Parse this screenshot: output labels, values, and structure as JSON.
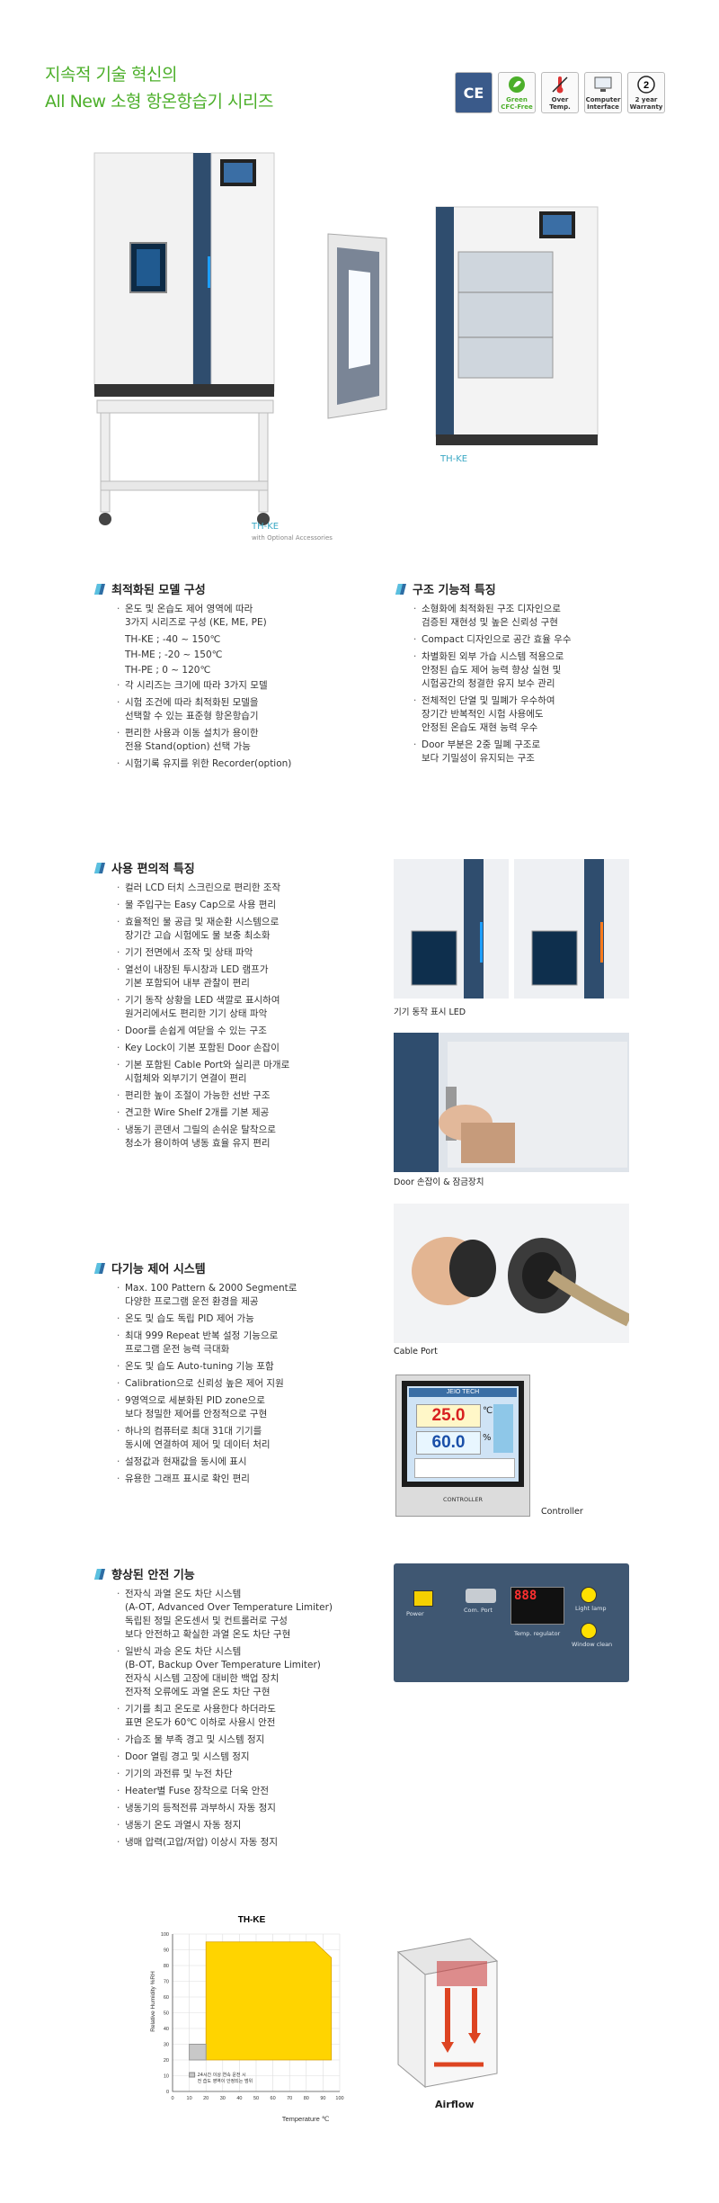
{
  "header": {
    "title_line1": "지속적 기술 혁신의",
    "title_line2": "All New 소형 항온항습기 시리즈",
    "badges": [
      {
        "label": "CE",
        "icon": "ce-icon"
      },
      {
        "label": "Green CFC-Free",
        "icon": "leaf-icon"
      },
      {
        "label": "Over Temp.",
        "icon": "thermometer-icon"
      },
      {
        "label": "Computer Interface",
        "icon": "computer-icon"
      },
      {
        "label": "2 year Warranty",
        "icon": "warranty-icon"
      }
    ]
  },
  "products": {
    "left_caption": "TH-KE",
    "left_subcaption": "with Optional Accessories",
    "right_caption": "TH-KE"
  },
  "section_model": {
    "heading": "최적화된 모델 구성",
    "items": [
      "온도 및 온습도 제어 영역에 따라\n3가지 시리즈로 구성 (KE, ME, PE)",
      "TH-KE ; -40 ~ 150℃",
      "TH-ME ; -20 ~ 150℃",
      "TH-PE ; 0 ~ 120℃",
      "각 시리즈는 크기에 따라 3가지 모델",
      "시험 조건에 따라 최적화된 모델을\n선택할 수 있는 표준형 항온항습기",
      "편리한 사용과 이동 설치가 용이한\n전용 Stand(option) 선택 가능",
      "시험기록 유지를 위한 Recorder(option)"
    ]
  },
  "section_structure": {
    "heading": "구조 기능적 특징",
    "items": [
      "소형화에 최적화된 구조 디자인으로\n검증된 재현성 및 높은 신뢰성 구현",
      "Compact 디자인으로 공간 효율 우수",
      "차별화된 외부 가습 시스템 적용으로\n안정된 습도 제어 능력 향상 실현 및\n시험공간의 청결한 유지 보수 관리",
      "전체적인 단열 및 밀폐가 우수하여\n장기간 반복적인 시험 사용에도\n안정된 온습도 재현 능력 우수",
      "Door 부분은 2중 밀폐 구조로\n보다 기밀성이 유지되는 구조"
    ]
  },
  "section_usability": {
    "heading": "사용 편의적 특징",
    "items": [
      "컬러 LCD 터치 스크린으로 편리한 조작",
      "물 주입구는 Easy Cap으로 사용 편리",
      "효율적인 물 공급 및 재순환 시스템으로\n장기간 고습 시험에도 물 보충 최소화",
      "기기 전면에서 조작 및 상태 파악",
      "열선이 내장된 투시창과 LED 램프가\n기본 포함되어 내부 관찰이 편리",
      "기기 동작 상황을 LED 색깔로 표시하여\n원거리에서도 편리한 기기 상태 파악",
      "Door를 손쉽게 여닫을 수 있는 구조",
      "Key Lock이 기본 포함된 Door 손잡이",
      "기본 포함된 Cable Port와 실리콘 마개로\n시험체와 외부기기 연결이 편리",
      "편리한 높이 조절이 가능한 선반 구조",
      "견고한 Wire Shelf 2개를 기본 제공",
      "냉동기 콘덴서 그릴의 손쉬운 탈착으로\n청소가 용이하여 냉동 효율 유지 편리"
    ]
  },
  "section_control": {
    "heading": "다기능 제어 시스템",
    "items": [
      "Max. 100 Pattern & 2000 Segment로\n다양한 프로그램 운전 환경을 제공",
      "온도 및 습도 독립 PID 제어 가능",
      "최대 999 Repeat 반복 설정 기능으로\n프로그램 운전 능력 극대화",
      "온도 및 습도 Auto-tuning 기능 포함",
      "Calibration으로 신뢰성 높은 제어 지원",
      "9영역으로 세분화된 PID zone으로\n보다 정밀한 제어를 안정적으로 구현",
      "하나의 컴퓨터로 최대 31대 기기를\n동시에 연결하여 제어 및 데이터 처리",
      "설정값과 현재값을 동시에 표시",
      "유용한 그래프 표시로 확인 편리"
    ]
  },
  "section_safety": {
    "heading": "향상된 안전 기능",
    "items": [
      "전자식 과열 온도 차단 시스템\n(A-OT, Advanced Over Temperature Limiter)\n독립된 정밀 온도센서 및 컨트롤러로 구성\n보다 안전하고 확실한 과열 온도 차단 구현",
      "일반식 과승 온도 차단 시스템\n(B-OT, Backup Over Temperature Limiter)\n전자식 시스템 고장에 대비한 백업 장치\n전자적 오류에도 과열 온도 차단 구현",
      "기기를 최고 온도로 사용한다 하더라도\n표면 온도가 60℃ 이하로 사용시 안전",
      "가습조 물 부족 경고 및 시스템 정지",
      "Door 열림 경고 및 시스템 정지",
      "기기의 과전류 및 누전 차단",
      "Heater별 Fuse 장착으로 더욱 안전",
      "냉동기의 등적전류 과부하시 자동 정지",
      "냉동기 온도 과열시 자동 정지",
      "냉매 압력(고압/저압) 이상시 자동 정지"
    ]
  },
  "photos": {
    "led_caption": "기기 동작 표시 LED",
    "door_caption": "Door 손잡이 & 잠금장치",
    "cable_caption": "Cable Port",
    "controller_caption": "Controller",
    "controller_brand": "JEIO TECH",
    "controller_temp": "25.0",
    "controller_humi": "60.0",
    "controller_temp_unit": "℃",
    "controller_humi_unit": "%",
    "controller_label": "CONTROLLER",
    "panel_power": "Power",
    "panel_comm": "Com. Port",
    "panel_temp_regulator": "Temp. regulator",
    "panel_light": "Light lamp",
    "panel_window": "Window clean",
    "panel_display": "888"
  },
  "chart_data": {
    "type": "area",
    "title": "TH-KE",
    "xlabel": "Temperature ℃",
    "ylabel": "Relative Humidity %RH",
    "xlim": [
      0,
      100
    ],
    "ylim": [
      0,
      100
    ],
    "x_ticks": [
      0,
      10,
      20,
      30,
      40,
      50,
      60,
      70,
      80,
      90,
      100
    ],
    "y_ticks": [
      0,
      10,
      20,
      30,
      40,
      50,
      60,
      70,
      80,
      90,
      100
    ],
    "polygon": [
      [
        20,
        20
      ],
      [
        20,
        95
      ],
      [
        85,
        95
      ],
      [
        95,
        85
      ],
      [
        95,
        20
      ],
      [
        60,
        20
      ],
      [
        40,
        20
      ]
    ],
    "grey_region": [
      [
        10,
        20
      ],
      [
        10,
        30
      ],
      [
        20,
        30
      ],
      [
        20,
        20
      ]
    ],
    "legend_text": "24시간 이상 연속 운전 시\n전 습도 영역이 안정되는 범위",
    "fill_color": "#ffd400",
    "grid": true
  },
  "airflow": {
    "caption": "Airflow"
  }
}
